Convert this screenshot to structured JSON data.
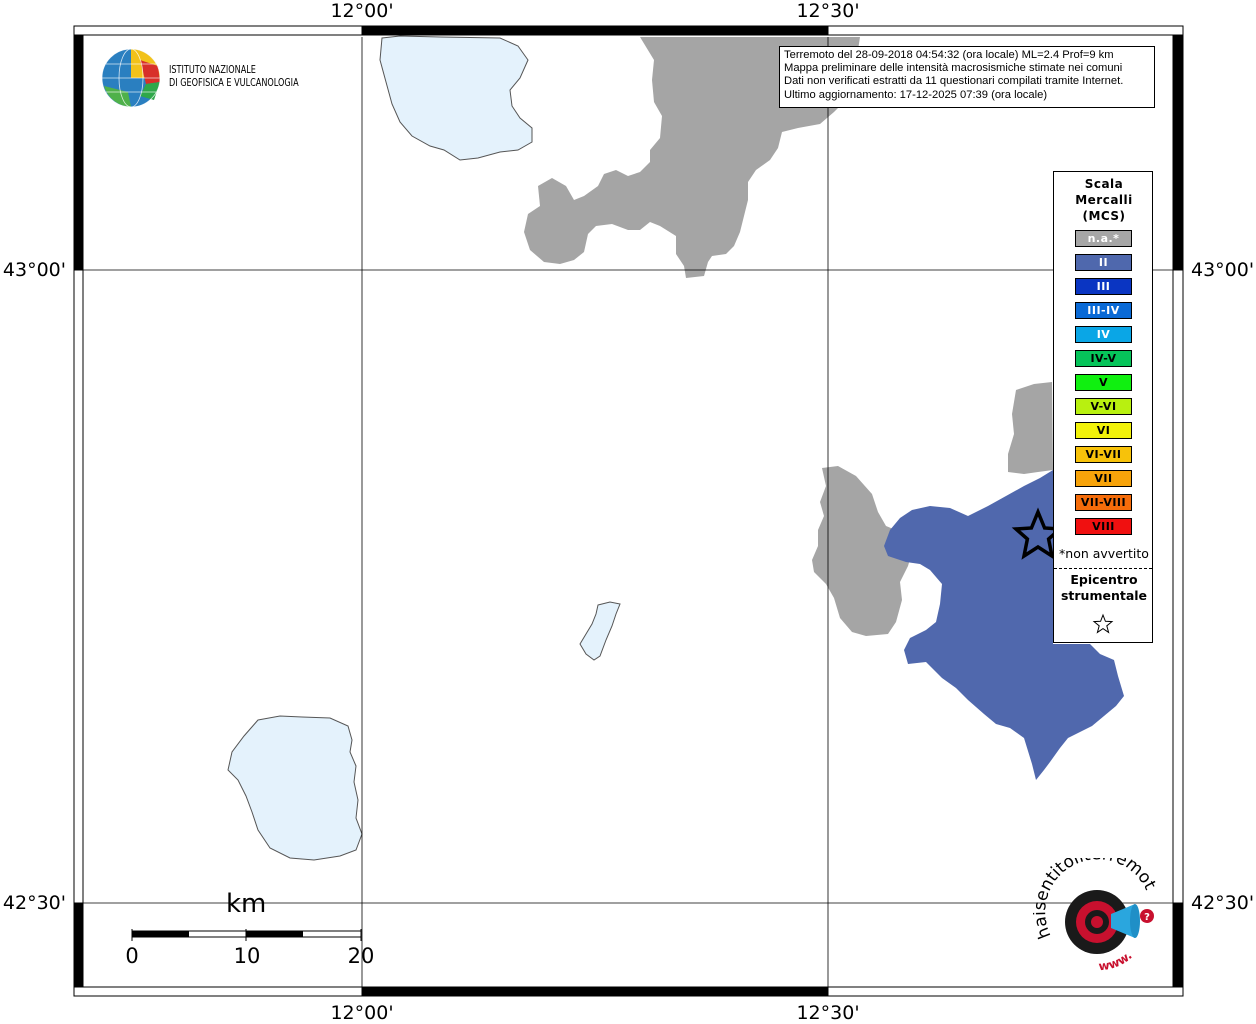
{
  "map": {
    "ticks_top": [
      "12°00'",
      "12°30'"
    ],
    "ticks_bottom": [
      "12°00'",
      "12°30'"
    ],
    "ticks_left": [
      "43°00'",
      "42°30'"
    ],
    "ticks_right": [
      "43°00'",
      "42°30'"
    ],
    "colors": {
      "lake": "#e4f2fc",
      "not_available": "#a5a5a5",
      "intensity_II": "#5068ad"
    }
  },
  "logo": {
    "line1": "ISTITUTO NAZIONALE",
    "line2": "DI GEOFISICA E VULCANOLOGIA"
  },
  "info": {
    "line1": "Terremoto del 28-09-2018 04:54:32 (ora locale) ML=2.4 Prof=9 km",
    "line2": "Mappa preliminare delle intensità macrosismiche stimate nei comuni",
    "line3": "Dati non verificati estratti da 11 questionari compilati tramite Internet.",
    "line4": "Ultimo aggiornamento: 17-12-2025 07:39 (ora locale)"
  },
  "legend": {
    "title_line1": "Scala",
    "title_line2": "Mercalli",
    "title_line3": "(MCS)",
    "items": [
      {
        "label": "n.a.*",
        "color": "#a6a6a6",
        "text_color": "#ffffff"
      },
      {
        "label": "II",
        "color": "#4f68ad",
        "text_color": "#ffffff"
      },
      {
        "label": "III",
        "color": "#0a35c2",
        "text_color": "#ffffff"
      },
      {
        "label": "III-IV",
        "color": "#0a6ad6",
        "text_color": "#ffffff"
      },
      {
        "label": "IV",
        "color": "#0aa6e6",
        "text_color": "#ffffff"
      },
      {
        "label": "IV-V",
        "color": "#06c45a",
        "text_color": "#000000"
      },
      {
        "label": "V",
        "color": "#10f010",
        "text_color": "#000000"
      },
      {
        "label": "V-VI",
        "color": "#b8f010",
        "text_color": "#000000"
      },
      {
        "label": "VI",
        "color": "#f2f20a",
        "text_color": "#000000"
      },
      {
        "label": "VI-VII",
        "color": "#f7c20a",
        "text_color": "#000000"
      },
      {
        "label": "VII",
        "color": "#f7a30a",
        "text_color": "#000000"
      },
      {
        "label": "VII-VIII",
        "color": "#f56c0a",
        "text_color": "#000000"
      },
      {
        "label": "VIII",
        "color": "#f01010",
        "text_color": "#000000"
      }
    ],
    "note": "*non avvertito",
    "epicenter_line1": "Epicentro",
    "epicenter_line2": "strumentale"
  },
  "scale_bar": {
    "unit": "km",
    "labels": [
      "0",
      "10",
      "20"
    ]
  },
  "brand": {
    "arc_text": "haisentitoilterremoto.it",
    "url_text": "www."
  }
}
